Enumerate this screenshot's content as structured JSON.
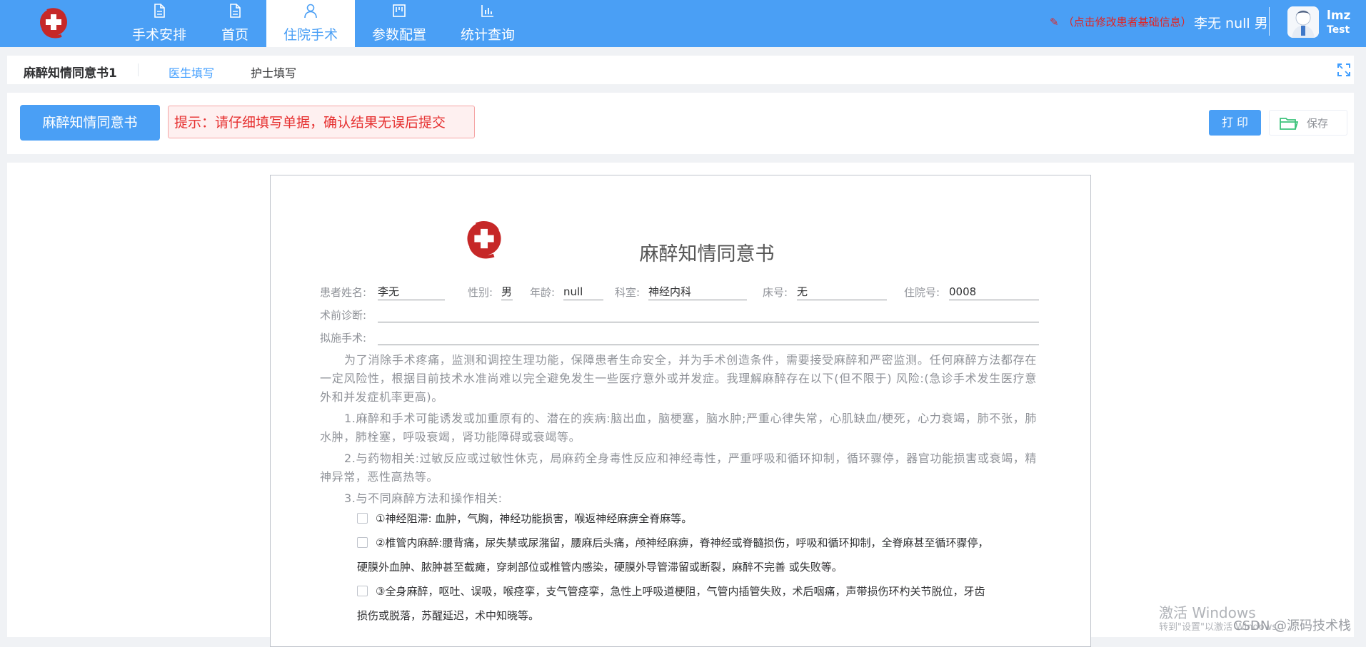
{
  "nav": {
    "items": [
      {
        "label": "手术安排",
        "icon": "document-icon"
      },
      {
        "label": "首页",
        "icon": "document-icon"
      },
      {
        "label": "住院手术",
        "icon": "user-icon"
      },
      {
        "label": "参数配置",
        "icon": "board-icon"
      },
      {
        "label": "统计查询",
        "icon": "bar-chart-icon"
      }
    ],
    "active_index": 2
  },
  "header": {
    "edit_hint": "（点击修改患者基础信息）",
    "patient_brief": "李无 null 男",
    "user_name": "lmz",
    "user_role": "Test"
  },
  "subtabs": {
    "document": "麻醉知情同意书1",
    "doctor": "医生填写",
    "nurse": "护士填写"
  },
  "toolbar": {
    "consent_button": "麻醉知情同意书",
    "tip": "提示：请仔细填写单据，确认结果无误后提交",
    "print": "打 印",
    "save": "保存"
  },
  "form": {
    "title": "麻醉知情同意书",
    "fields": {
      "name_label": "患者姓名:",
      "name": "李无",
      "gender_label": "性别:",
      "gender": "男",
      "age_label": "年龄:",
      "age": "null",
      "dept_label": "科室:",
      "dept": "神经内科",
      "bed_label": "床号:",
      "bed": "无",
      "admission_label": "住院号:",
      "admission": "0008",
      "diagnosis_label": "术前诊断:",
      "diagnosis": "",
      "surgery_label": "拟施手术:",
      "surgery": ""
    },
    "intro": "为了消除手术疼痛，监测和调控生理功能，保障患者生命安全，并为手术创造条件，需要接受麻醉和严密监测。任何麻醉方法都存在一定风险性，根据目前技术水准尚难以完全避免发生一些医疗意外或并发症。我理解麻醉存在以下(但不限于) 风险:(急诊手术发生医疗意外和并发症机率更高)。",
    "item1": "1.麻醉和手术可能诱发或加重原有的、潜在的疾病:脑出血，脑梗塞，脑水肿;严重心律失常，心肌缺血/梗死，心力衰竭，肺不张，肺水肿，肺栓塞，呼吸衰竭，肾功能障碍或衰竭等。",
    "item2": "2.与药物相关:过敏反应或过敏性休克，局麻药全身毒性反应和神经毒性，严重呼吸和循环抑制，循环骤停，器官功能损害或衰竭，精神异常，恶性高热等。",
    "item3": "3.与不同麻醉方法和操作相关:",
    "checks": {
      "c1": "①神经阻滞: 血肿，气胸，神经功能损害，喉返神经麻痹全脊麻等。",
      "c2": "②椎管内麻醉:腰背痛，尿失禁或尿潴留，腰麻后头痛，颅神经麻痹，脊神经或脊髓损伤，呼吸和循环抑制，全脊麻甚至循环骤停，",
      "c2b": "硬膜外血肿、脓肿甚至截瘫，穿刺部位或椎管内感染，硬膜外导管滞留或断裂，麻醉不完善 或失败等。",
      "c3": "③全身麻醉，呕吐、误吸，喉痉挛，支气管痉挛，急性上呼吸道梗阻，气管内插管失败，术后咽痛，声带损伤环杓关节脱位，牙齿",
      "c3b": "损伤或脱落，苏醒延迟，术中知晓等。"
    }
  },
  "watermark": {
    "activate": "激活 Windows",
    "activate_sub": "转到\"设置\"以激活 Windows。",
    "csdn": "CSDN @源码技术栈"
  }
}
